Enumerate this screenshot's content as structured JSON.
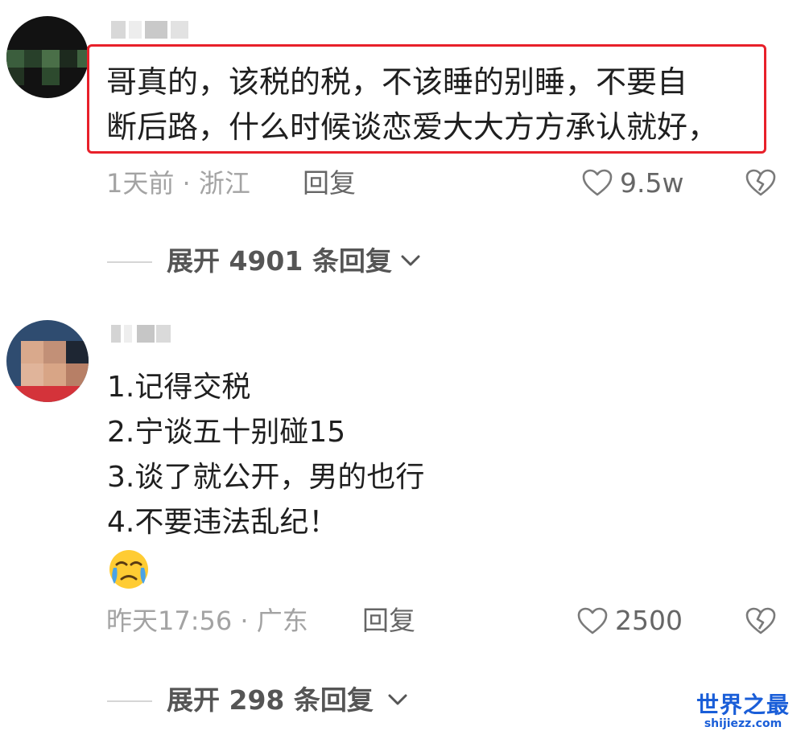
{
  "comments": [
    {
      "lines": [
        "哥真的，该税的税，不该睡的别睡，不要自",
        "断后路，什么时候谈恋爱大大方方承认就好，"
      ],
      "meta": "1天前 · 浙江",
      "reply_label": "回复",
      "likes": "9.5w",
      "expand_label": "展开 4901 条回复"
    },
    {
      "lines": [
        "1.记得交税",
        "2.宁谈五十别碰15",
        "3.谈了就公开，男的也行",
        "4.不要违法乱纪！"
      ],
      "emoji": "crying-face-emoji",
      "meta": "昨天17:56 · 广东",
      "reply_label": "回复",
      "likes": "2500",
      "expand_label": "展开 298 条回复"
    }
  ],
  "icons": {
    "like": "heart-outline-icon",
    "dislike": "broken-heart-icon",
    "expand": "chevron-down-icon"
  },
  "colors": {
    "highlight_border": "#e8202a",
    "watermark": "#1a5ed8"
  },
  "watermark": {
    "title": "世界之最",
    "url": "shijiezz.com"
  }
}
